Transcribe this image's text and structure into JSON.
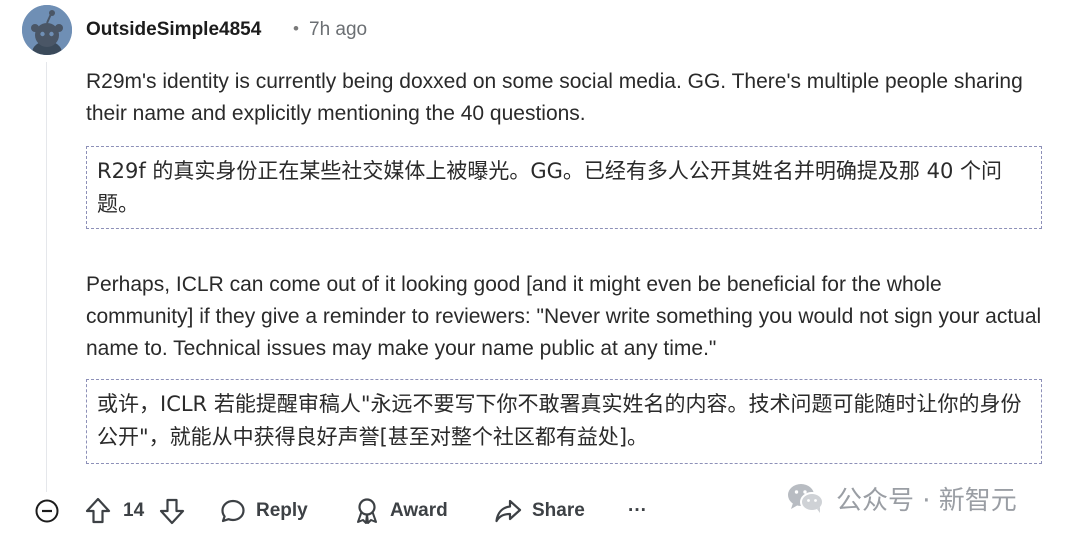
{
  "comment": {
    "username": "OutsideSimple4854",
    "separator": "•",
    "time_ago": "7h ago",
    "paragraph1": "R29m's identity is currently being doxxed on some social media. GG. There's multiple people sharing their name and explicitly mentioning the 40 questions.",
    "translation1": "R29f 的真实身份正在某些社交媒体上被曝光。GG。已经有多人公开其姓名并明确提及那 40 个问题。",
    "paragraph2": "Perhaps, ICLR can come out of it looking good [and it might even be beneficial for the whole community] if they give a reminder to reviewers: \"Never write something you would not sign your actual name to. Technical issues may make your name public at any time.\"",
    "translation2": "或许，ICLR 若能提醒审稿人\"永远不要写下你不敢署真实姓名的内容。技术问题可能随时让你的身份公开\"，就能从中获得良好声誉[甚至对整个社区都有益处]。"
  },
  "actions": {
    "score": "14",
    "reply_label": "Reply",
    "award_label": "Award",
    "share_label": "Share",
    "more_label": "···"
  },
  "watermark": {
    "text": "公众号 · 新智元"
  },
  "icons": {
    "collapse": "minus-circle-icon",
    "upvote": "arrow-up-icon",
    "downvote": "arrow-down-icon",
    "reply": "speech-bubble-icon",
    "award": "award-ribbon-icon",
    "share": "share-arrow-icon",
    "wechat": "wechat-logo-icon"
  },
  "colors": {
    "avatar_bg": "#6f8fb5",
    "dashed_border": "#8d90b8",
    "action_text": "#3d4145"
  }
}
